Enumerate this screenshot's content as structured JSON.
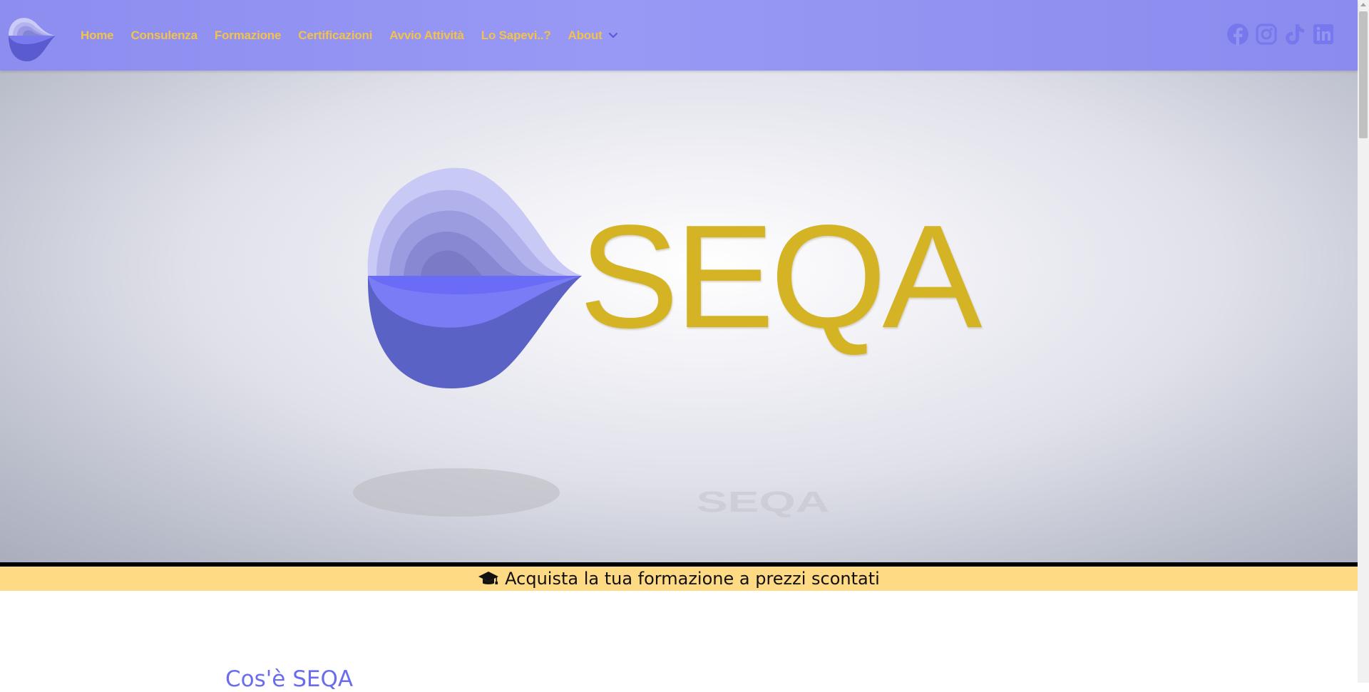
{
  "colors": {
    "navbar": "#9494f3",
    "nav_text": "#f2c24c",
    "icon": "#7878ee",
    "brand_gold": "#d4b324",
    "banner": "#ffda84",
    "section_title": "#6a6cf0"
  },
  "nav": {
    "items": [
      {
        "label": "Home"
      },
      {
        "label": "Consulenza"
      },
      {
        "label": "Formazione"
      },
      {
        "label": "Certificazioni"
      },
      {
        "label": "Avvio Attività"
      },
      {
        "label": "Lo Sapevi..?"
      },
      {
        "label": "About",
        "has_dropdown": true
      }
    ],
    "dropdown_icon": "chevron-down-icon"
  },
  "social": [
    "facebook-icon",
    "instagram-icon",
    "tiktok-icon",
    "linkedin-icon"
  ],
  "hero": {
    "brand": "SEQA",
    "logo_icon": "seqa-drop-logo"
  },
  "banner": {
    "icon": "graduation-cap-icon",
    "text": "Acquista la tua formazione a prezzi scontati"
  },
  "section": {
    "title": "Cos'è SEQA"
  }
}
